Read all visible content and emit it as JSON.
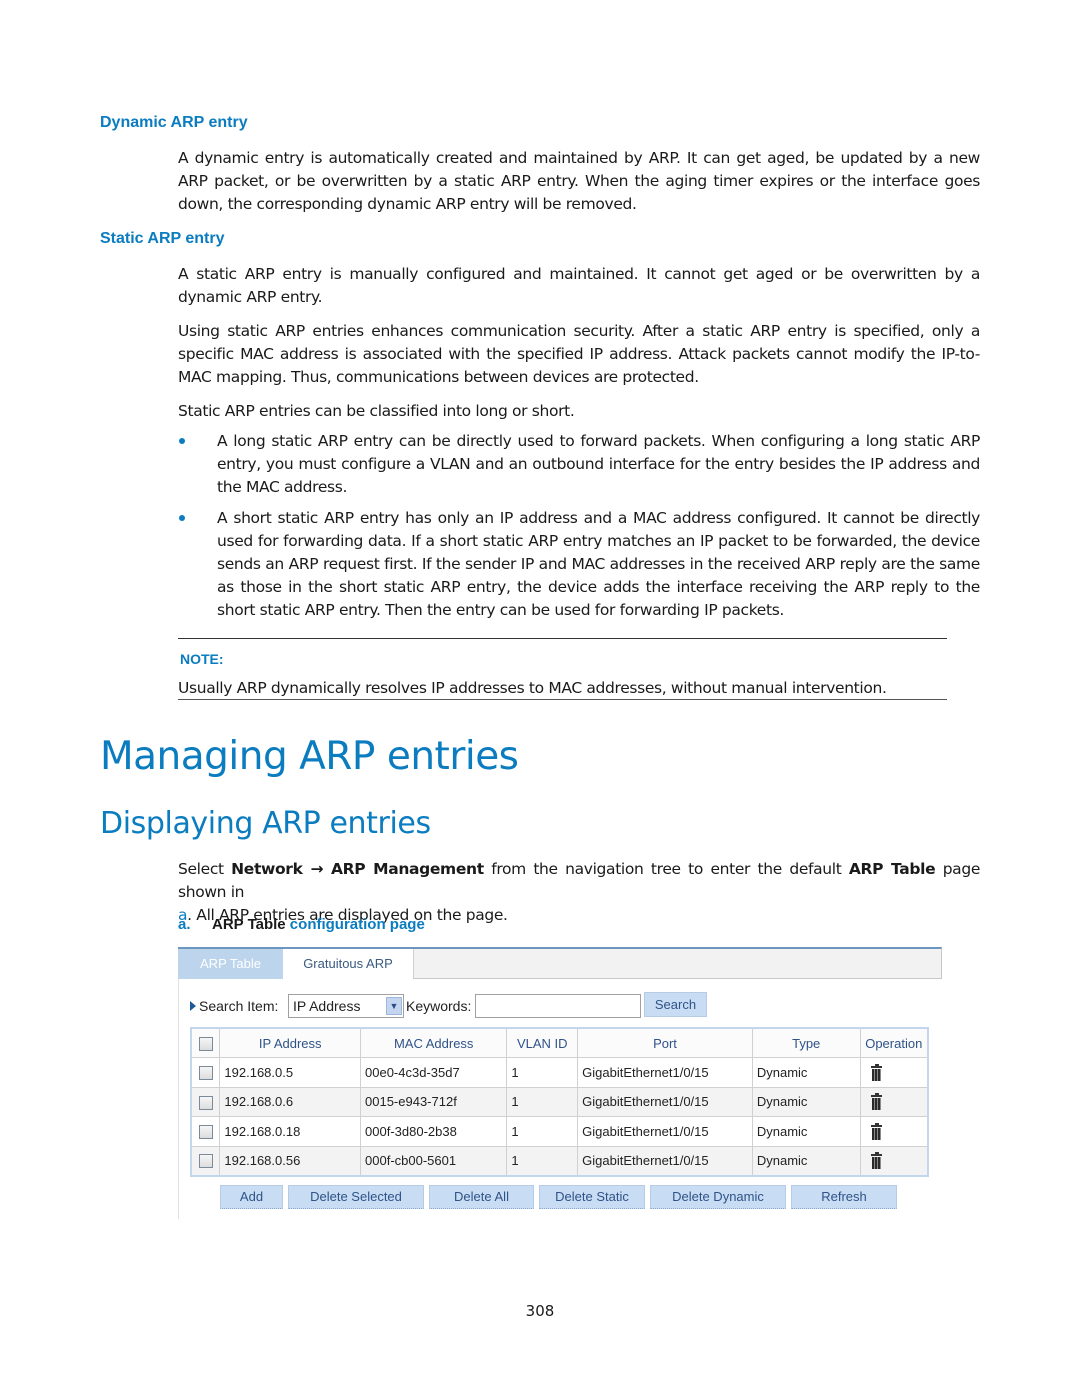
{
  "sections": {
    "dynamic_heading": "Dynamic ARP entry",
    "dynamic_para": "A dynamic entry is automatically created and maintained by ARP. It can get aged, be updated by a new ARP packet, or be overwritten by a static ARP entry. When the aging timer expires or the interface goes down, the corresponding dynamic ARP entry will be removed.",
    "static_heading": "Static ARP entry",
    "static_para1": "A static ARP entry is manually configured and maintained. It cannot get aged or be overwritten by a dynamic ARP entry.",
    "static_para2": "Using static ARP entries enhances communication security. After a static ARP entry is specified, only a specific MAC address is associated with the specified IP address. Attack packets cannot modify the IP-to-MAC mapping. Thus, communications between devices are protected.",
    "static_para3": "Static ARP entries can be classified into long or short.",
    "bullets": [
      "A long static ARP entry can be directly used to forward packets. When configuring a long static ARP entry, you must configure a VLAN and an outbound interface for the entry besides the IP address and the MAC address.",
      "A short static ARP entry has only an IP address and a MAC address configured. It cannot be directly used for forwarding data. If a short static ARP entry matches an IP packet to be forwarded, the device sends an ARP request first. If the sender IP and MAC addresses in the received ARP reply are the same as those in the short static ARP entry, the device adds the interface receiving the ARP reply to the short static ARP entry. Then the entry can be used for forwarding IP packets."
    ]
  },
  "note": {
    "label": "NOTE:",
    "text": "Usually ARP dynamically resolves IP addresses to MAC addresses, without manual intervention."
  },
  "headings": {
    "h1": "Managing ARP entries",
    "h2": "Displaying ARP entries"
  },
  "intro": {
    "p1_a": "Select ",
    "p1_network": "Network",
    "p1_arrow": " → ",
    "p1_arpmgmt": "ARP Management",
    "p1_b": " from the navigation tree to enter the default ",
    "p1_arptable": "ARP Table",
    "p1_c": " page shown in",
    "p2_ref": "a",
    "p2_rest": ". All ARP entries are displayed on the page."
  },
  "figure": {
    "number": "a.",
    "title_bold": "ARP Table",
    "title_rest": " configuration page"
  },
  "ui": {
    "tabs": [
      "ARP Table",
      "Gratuitous ARP"
    ],
    "search_label": "Search Item:",
    "search_select": "IP Address",
    "keywords_label": "Keywords:",
    "keywords_value": "",
    "search_button": "Search",
    "columns": [
      "IP Address",
      "MAC Address",
      "VLAN ID",
      "Port",
      "Type",
      "Operation"
    ],
    "rows": [
      {
        "ip": "192.168.0.5",
        "mac": "00e0-4c3d-35d7",
        "vlan": "1",
        "port": "GigabitEthernet1/0/15",
        "type": "Dynamic"
      },
      {
        "ip": "192.168.0.6",
        "mac": "0015-e943-712f",
        "vlan": "1",
        "port": "GigabitEthernet1/0/15",
        "type": "Dynamic"
      },
      {
        "ip": "192.168.0.18",
        "mac": "000f-3d80-2b38",
        "vlan": "1",
        "port": "GigabitEthernet1/0/15",
        "type": "Dynamic"
      },
      {
        "ip": "192.168.0.56",
        "mac": "000f-cb00-5601",
        "vlan": "1",
        "port": "GigabitEthernet1/0/15",
        "type": "Dynamic"
      }
    ],
    "buttons": [
      "Add",
      "Delete Selected",
      "Delete All",
      "Delete Static",
      "Delete Dynamic",
      "Refresh"
    ]
  },
  "page_number": "308",
  "colors": {
    "accent": "#0a7cbf",
    "ui_button": "#c8dcf3",
    "ui_header_text": "#2f5388"
  }
}
